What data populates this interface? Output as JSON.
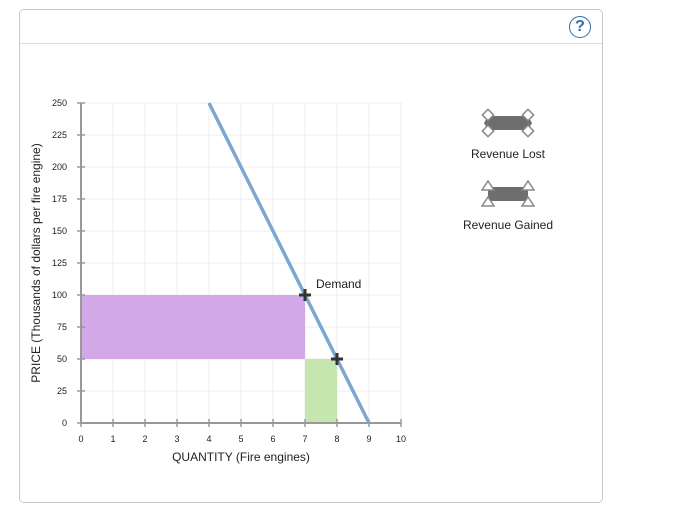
{
  "header": {
    "help_label": "?"
  },
  "chart_data": {
    "type": "line",
    "title": "",
    "xlabel": "QUANTITY (Fire engines)",
    "ylabel": "PRICE (Thousands of dollars per fire engine)",
    "xlim": [
      0,
      10
    ],
    "ylim": [
      0,
      250
    ],
    "x_ticks": [
      0,
      1,
      2,
      3,
      4,
      5,
      6,
      7,
      8,
      9,
      10
    ],
    "y_ticks": [
      0,
      25,
      50,
      75,
      100,
      125,
      150,
      175,
      200,
      225,
      250
    ],
    "grid": true,
    "series": [
      {
        "name": "Demand",
        "color": "#7ba7d0",
        "points": [
          [
            4,
            250
          ],
          [
            9,
            0
          ]
        ]
      }
    ],
    "markers": [
      {
        "name": "point-a",
        "x": 7,
        "y": 100
      },
      {
        "name": "point-b",
        "x": 8,
        "y": 50
      }
    ],
    "regions": [
      {
        "name": "Revenue Lost",
        "color": "#d3a8e6",
        "x": [
          0,
          7
        ],
        "y": [
          50,
          100
        ]
      },
      {
        "name": "Revenue Gained",
        "color": "#c6e6b0",
        "x": [
          7,
          8
        ],
        "y": [
          0,
          50
        ]
      }
    ],
    "legend": {
      "placement": "right",
      "items": [
        {
          "label": "Revenue Lost",
          "shape": "rectangle-diamond-handles",
          "color": "#6e6e6e"
        },
        {
          "label": "Revenue Gained",
          "shape": "rectangle-triangle-handles",
          "color": "#6e6e6e"
        }
      ]
    },
    "annotations": [
      {
        "text": "Demand",
        "x": 7,
        "y": 100
      }
    ]
  }
}
